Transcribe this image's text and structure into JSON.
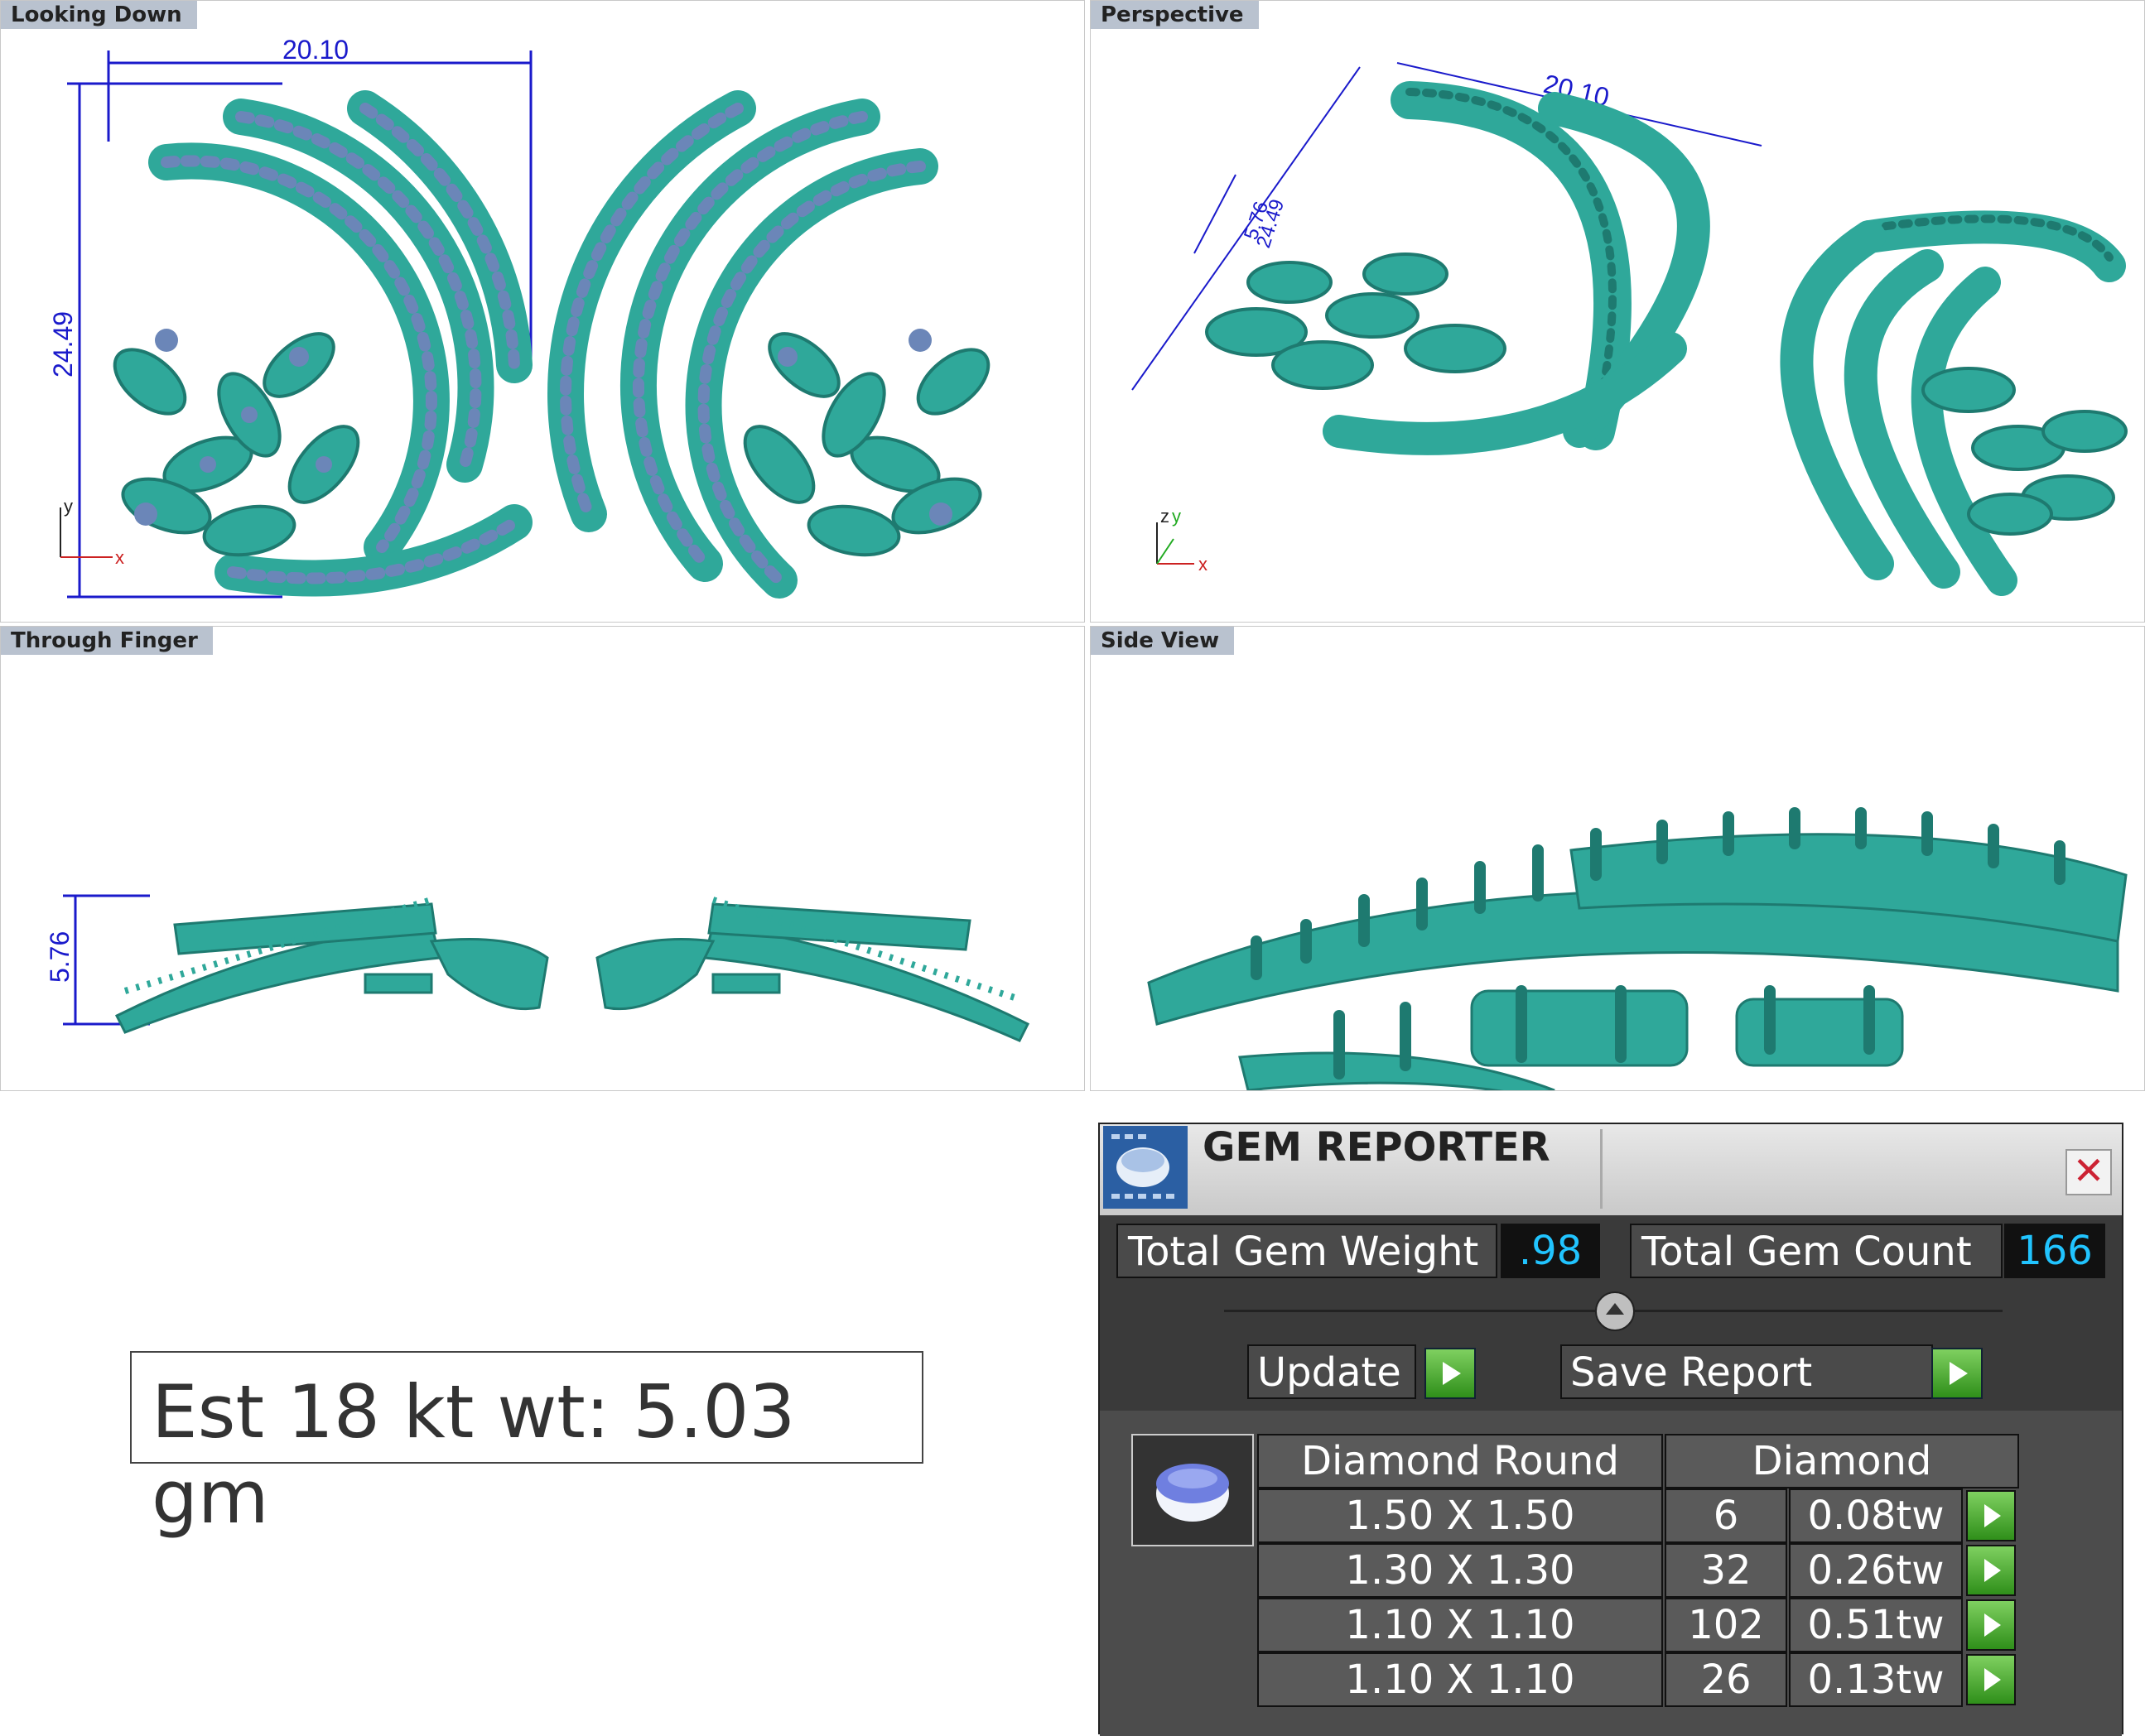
{
  "viewports": {
    "top_left": {
      "title": "Looking Down",
      "dim_width": "20.10",
      "dim_height": "24.49",
      "axis_y": "y",
      "axis_x": "x"
    },
    "top_right": {
      "title": "Perspective",
      "dim_width": "20.10",
      "dim_a": "24.49",
      "dim_b": "5.76",
      "axis_z": "z",
      "axis_y": "y",
      "axis_x": "x"
    },
    "bottom_left": {
      "title": "Through Finger",
      "dim_height": "5.76"
    },
    "bottom_right": {
      "title": "Side View"
    }
  },
  "estimate": {
    "text": "Est 18 kt wt: 5.03 gm"
  },
  "gem_reporter": {
    "title": "GEM REPORTER",
    "close_glyph": "✕",
    "total_weight_label": "Total Gem Weight",
    "total_weight_value": ".98",
    "total_count_label": "Total Gem Count",
    "total_count_value": "166",
    "update_label": "Update",
    "save_label": "Save Report",
    "table": {
      "headers": [
        "Diamond Round",
        "Diamond"
      ],
      "rows": [
        {
          "size": "1.50 X 1.50",
          "count": "6",
          "weight": "0.08tw"
        },
        {
          "size": "1.30 X 1.30",
          "count": "32",
          "weight": "0.26tw"
        },
        {
          "size": "1.10 X 1.10",
          "count": "102",
          "weight": "0.51tw"
        },
        {
          "size": "1.10 X 1.10",
          "count": "26",
          "weight": "0.13tw"
        }
      ]
    }
  },
  "colors": {
    "metal": "#2fa89a",
    "metal_dark": "#1e7a70",
    "stone": "#6b86b8",
    "dimension": "#1a1acb",
    "gem_value": "#21c4ff"
  }
}
